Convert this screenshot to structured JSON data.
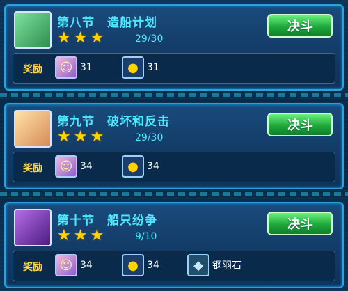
{
  "chapters": [
    {
      "title": "第八节　造船计划",
      "progress": "29/30",
      "stars": 3,
      "button": "决斗",
      "reward_label": "奖励",
      "rewards": [
        {
          "icon": "character-card-icon",
          "count": "31"
        },
        {
          "icon": "coin-icon",
          "count": "31"
        }
      ]
    },
    {
      "title": "第九节　破坏和反击",
      "progress": "29/30",
      "stars": 3,
      "button": "决斗",
      "reward_label": "奖励",
      "rewards": [
        {
          "icon": "character-card-icon",
          "count": "34"
        },
        {
          "icon": "coin-icon",
          "count": "34"
        }
      ]
    },
    {
      "title": "第十节　船只纷争",
      "progress": "9/10",
      "stars": 3,
      "button": "决斗",
      "reward_label": "奖励",
      "rewards": [
        {
          "icon": "character-card-icon",
          "count": "34"
        },
        {
          "icon": "coin-icon",
          "count": "34"
        },
        {
          "icon": "gem-icon",
          "name": "钢羽石"
        }
      ]
    }
  ],
  "colors": {
    "title": "#4de9ff",
    "button": "#1fa83c",
    "reward_label": "#ffd84a",
    "star": "#ffd200"
  }
}
